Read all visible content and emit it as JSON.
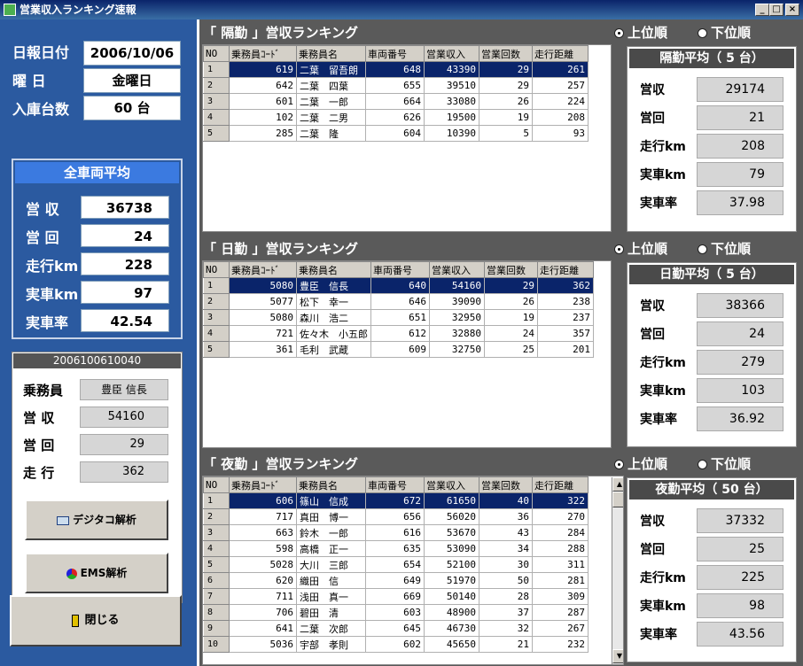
{
  "window": {
    "title": "営業収入ランキング速報",
    "min": "_",
    "max": "□",
    "close": "×"
  },
  "left": {
    "date_label": "日報日付",
    "date_value": "2006/10/06",
    "weekday_label": "曜 日",
    "weekday_value": "金曜日",
    "count_label": "入庫台数",
    "count_value": "60 台",
    "avg": {
      "title": "全車両平均",
      "rows": [
        {
          "label": "営 収",
          "value": "36738"
        },
        {
          "label": "営 回",
          "value": "24"
        },
        {
          "label": "走行km",
          "value": "228"
        },
        {
          "label": "実車km",
          "value": "97"
        },
        {
          "label": "実車率",
          "value": "42.54"
        }
      ]
    },
    "driver": {
      "id": "2006100610040",
      "rows": [
        {
          "label": "乗務員",
          "value": "豊臣 信長"
        },
        {
          "label": "営 収",
          "value": "54160"
        },
        {
          "label": "営 回",
          "value": "29"
        },
        {
          "label": "走 行",
          "value": "362"
        }
      ]
    },
    "btn_digi": "デジタコ解析",
    "btn_ems": "EMS解析",
    "btn_close": "閉じる"
  },
  "columns": [
    "NO",
    "乗務員ｺｰﾄﾞ",
    "乗務員名",
    "車両番号",
    "営業収入",
    "営業回数",
    "走行距離"
  ],
  "radio_up": "上位順",
  "radio_down": "下位順",
  "sections": [
    {
      "title": "「 隔勤 」営収ランキング",
      "avg_title": "隔勤平均（ 5 台）",
      "rows": [
        [
          "1",
          "619",
          "二葉　留吾朗",
          "648",
          "43390",
          "29",
          "261"
        ],
        [
          "2",
          "642",
          "二葉　四葉",
          "655",
          "39510",
          "29",
          "257"
        ],
        [
          "3",
          "601",
          "二葉　一郎",
          "664",
          "33080",
          "26",
          "224"
        ],
        [
          "4",
          "102",
          "二葉　二男",
          "626",
          "19500",
          "19",
          "208"
        ],
        [
          "5",
          "285",
          "二葉　隆",
          "604",
          "10390",
          "5",
          "93"
        ]
      ],
      "avg": [
        [
          "営収",
          "29174"
        ],
        [
          "営回",
          "21"
        ],
        [
          "走行km",
          "208"
        ],
        [
          "実車km",
          "79"
        ],
        [
          "実車率",
          "37.98"
        ]
      ]
    },
    {
      "title": "「 日勤 」営収ランキング",
      "avg_title": "日勤平均（ 5 台）",
      "rows": [
        [
          "1",
          "5080",
          "豊臣　信長",
          "640",
          "54160",
          "29",
          "362"
        ],
        [
          "2",
          "5077",
          "松下　幸一",
          "646",
          "39090",
          "26",
          "238"
        ],
        [
          "3",
          "5080",
          "森川　浩二",
          "651",
          "32950",
          "19",
          "237"
        ],
        [
          "4",
          "721",
          "佐々木　小五郎",
          "612",
          "32880",
          "24",
          "357"
        ],
        [
          "5",
          "361",
          "毛利　武蔵",
          "609",
          "32750",
          "25",
          "201"
        ]
      ],
      "avg": [
        [
          "営収",
          "38366"
        ],
        [
          "営回",
          "24"
        ],
        [
          "走行km",
          "279"
        ],
        [
          "実車km",
          "103"
        ],
        [
          "実車率",
          "36.92"
        ]
      ]
    },
    {
      "title": "「 夜勤 」営収ランキング",
      "avg_title": "夜勤平均（ 50 台）",
      "rows": [
        [
          "1",
          "606",
          "篠山　信成",
          "672",
          "61650",
          "40",
          "322"
        ],
        [
          "2",
          "717",
          "真田　博一",
          "656",
          "56020",
          "36",
          "270"
        ],
        [
          "3",
          "663",
          "鈴木　一郎",
          "616",
          "53670",
          "43",
          "284"
        ],
        [
          "4",
          "598",
          "高橋　正一",
          "635",
          "53090",
          "34",
          "288"
        ],
        [
          "5",
          "5028",
          "大川　三郎",
          "654",
          "52100",
          "30",
          "311"
        ],
        [
          "6",
          "620",
          "織田　信",
          "649",
          "51970",
          "50",
          "281"
        ],
        [
          "7",
          "711",
          "浅田　真一",
          "669",
          "50140",
          "28",
          "309"
        ],
        [
          "8",
          "706",
          "碧田　清",
          "603",
          "48900",
          "37",
          "287"
        ],
        [
          "9",
          "641",
          "二葉　次郎",
          "645",
          "46730",
          "32",
          "267"
        ],
        [
          "10",
          "5036",
          "宇部　孝則",
          "602",
          "45650",
          "21",
          "232"
        ]
      ],
      "avg": [
        [
          "営収",
          "37332"
        ],
        [
          "営回",
          "25"
        ],
        [
          "走行km",
          "225"
        ],
        [
          "実車km",
          "98"
        ],
        [
          "実車率",
          "43.56"
        ]
      ]
    }
  ]
}
